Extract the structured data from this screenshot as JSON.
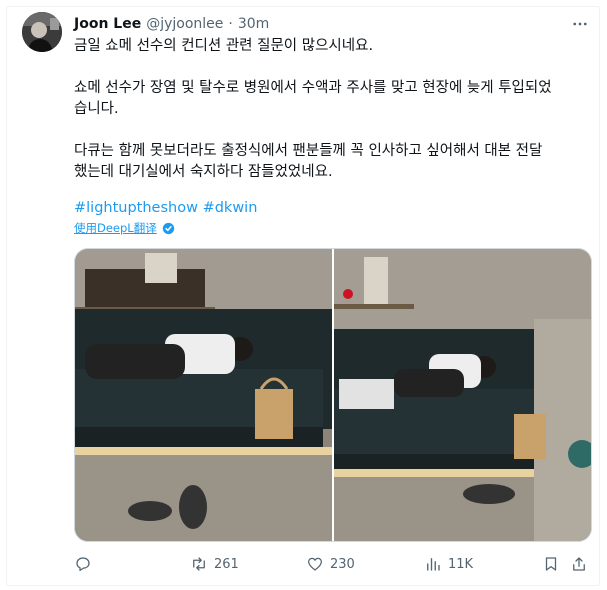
{
  "tweet": {
    "author_name": "Joon Lee",
    "handle": "@jyjoonlee",
    "separator": "·",
    "time": "30m",
    "paragraphs": [
      [
        "금일 쇼메 선수의 컨디션  관련 질문이 많으시네요."
      ],
      [
        "쇼메 선수가 장염 및 탈수로 병원에서 수액과 주사를 맞고 현장에 늦게 투입되었",
        "습니다."
      ],
      [
        "다큐는 함께 못보더라도 출정식에서 팬분들께 꼭 인사하고 싶어해서 대본 전달",
        "했는데 대기실에서 숙지하다 잠들었었네요."
      ]
    ],
    "hashtags": [
      "#lightuptheshow",
      "#dkwin"
    ],
    "translate_label": "使用DeepL翻译",
    "media_count": 2
  },
  "actions": {
    "reply": "",
    "retweet": "261",
    "like": "230",
    "views": "11K"
  },
  "colors": {
    "accent": "#1d9bf0",
    "text": "#0f1419",
    "secondary": "#536471"
  }
}
